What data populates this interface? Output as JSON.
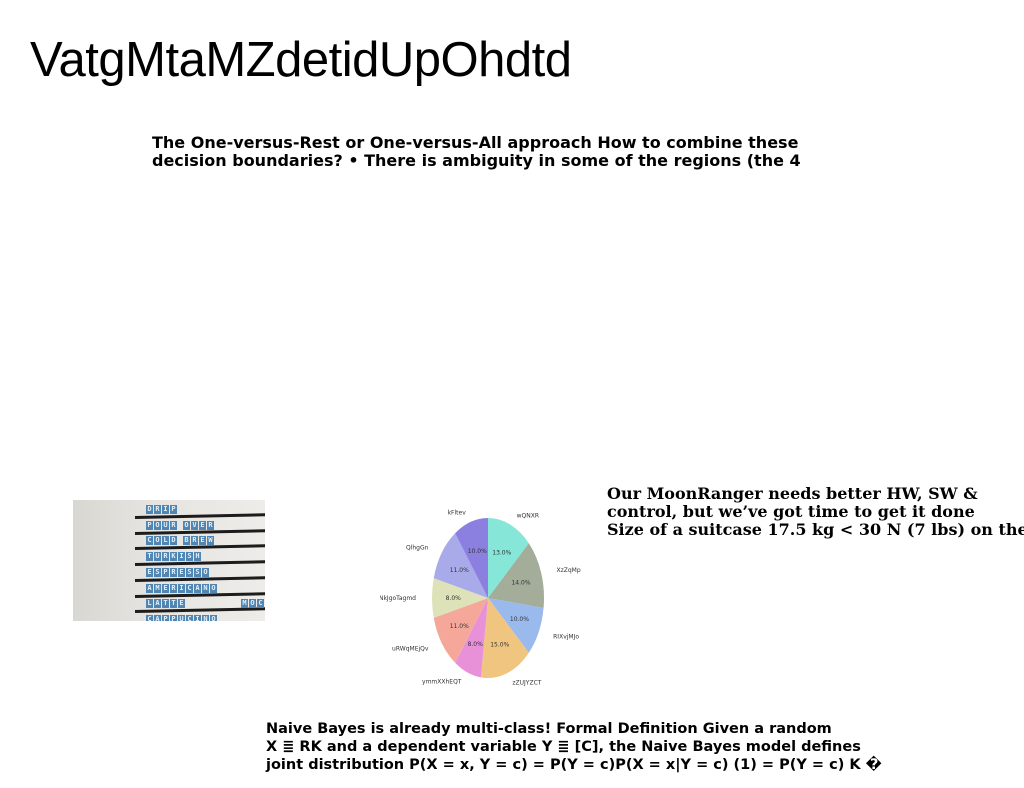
{
  "title": "VatgMtaMZdetidUpOhdtd",
  "text_block_1": {
    "lines": [
      "The One-versus-Rest or One-versus-All approach How to combine these",
      "decision boundaries? • There is ambiguity in some of the regions (the 4"
    ]
  },
  "text_block_2": {
    "lines": [
      "Our MoonRanger needs better HW, SW &",
      "control, but we’ve got time to get it done",
      "Size of a suitcase 17.5 kg < 30 N (7 lbs) on the"
    ]
  },
  "text_block_3": {
    "lines": [
      "Naive Bayes is already multi-class! Formal Definition Given a random",
      "X ≣ RK and a dependent variable Y ≣ [C], the Naive Bayes model defines",
      "joint distribution P(X = x, Y = c) = P(Y = c)P(X = x|Y = c) (1) = P(Y = c) K �"
    ]
  },
  "photo": {
    "rows": [
      "DRIP",
      "POUR OVER",
      "COLD BREW",
      "TURKISH",
      "ESPRESSO",
      "AMERICANO",
      "LATTE",
      "CAPPUCINO"
    ],
    "extra": "MOC"
  },
  "chart_data": {
    "type": "pie",
    "labels": [
      "wQNXR",
      "XzZqMp",
      "RIXvjMJo",
      "zZUJYZCT",
      "ymmXXhEQT",
      "uRWqMEjQv",
      "NkJgoTagmd",
      "QlhgGn",
      "kFltev"
    ],
    "values": [
      13.0,
      14.0,
      10.0,
      15.0,
      8.0,
      11.0,
      8.0,
      11.0,
      10.0
    ],
    "value_labels": [
      "13.0%",
      "14.0%",
      "10.0%",
      "15.0%",
      "8.0%",
      "11.0%",
      "8.0%",
      "11.0%",
      "10.0%"
    ],
    "colors": [
      "#86e6d8",
      "#a3ad9a",
      "#9ab9ec",
      "#f0c57f",
      "#e891d8",
      "#f5a89a",
      "#dde2b8",
      "#a9aaea",
      "#8b7fe0"
    ]
  }
}
